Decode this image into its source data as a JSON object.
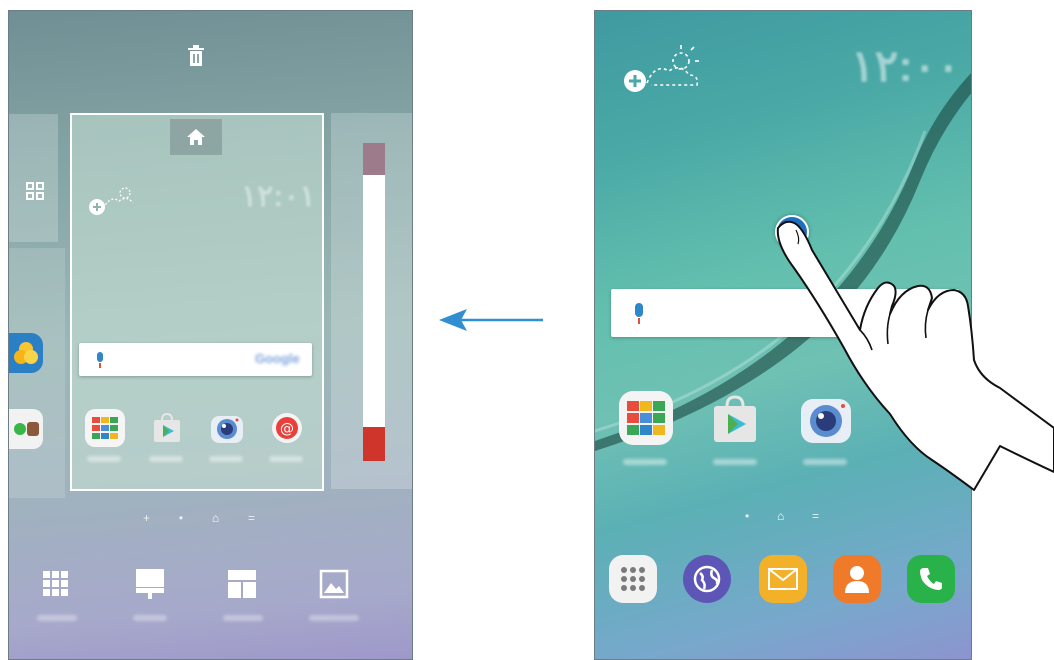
{
  "left_screen": {
    "trash_icon": "trash-icon",
    "home_icon": "home-icon",
    "clock_text": "١٢:٠١",
    "search_brand": "Google",
    "mic_icon": "mic-icon",
    "apps_icon": "apps-grid-icon",
    "dock_apps": [
      "google-folder-icon",
      "play-store-icon",
      "camera-icon",
      "email-icon"
    ],
    "page_indicators": [
      "+",
      "•",
      "⌂",
      "="
    ],
    "edit_menu": [
      "wallpapers-icon",
      "widgets-icon",
      "themes-icon",
      "screen-grid-icon"
    ]
  },
  "right_screen": {
    "clock_text": "١٢:٠٠",
    "page_indicators": [
      "•",
      "⌂",
      "="
    ],
    "home_apps": [
      "google-folder-icon",
      "play-store-icon",
      "camera-icon"
    ],
    "dock_apps": [
      "apps-icon",
      "internet-icon",
      "email-icon",
      "contacts-icon",
      "phone-icon"
    ]
  },
  "colors": {
    "accent_blue": "#2f86c9",
    "touch_dot": "#1e6fbf",
    "arrow": "#2f8fd0"
  }
}
